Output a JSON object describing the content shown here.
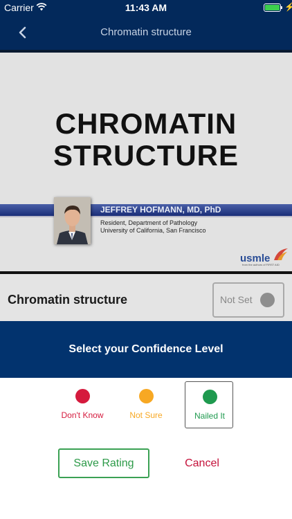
{
  "status_bar": {
    "carrier": "Carrier",
    "time": "11:43 AM",
    "wifi_icon": "wifi-icon",
    "battery_icon": "battery-icon",
    "charging_icon": "bolt-icon",
    "battery_level": 1.0,
    "battery_color": "#3ccf4e"
  },
  "nav": {
    "back_icon": "chevron-left-icon",
    "title": "Chromatin structure"
  },
  "slide": {
    "title_line1": "CHROMATIN",
    "title_line2": "STRUCTURE",
    "presenter_name": "JEFFREY HOFMANN, MD, PhD",
    "presenter_role_line1": "Resident, Department of Pathology",
    "presenter_role_line2": "University of California, San Francisco",
    "logo_text": "usmle",
    "logo_subtext": "from the authors of FIRST AID"
  },
  "topic": {
    "title": "Chromatin structure",
    "rating_label": "Not Set",
    "rating_color": "#8e8e8e"
  },
  "confidence": {
    "header": "Select your Confidence Level",
    "options": [
      {
        "label": "Don't Know",
        "color": "#d51a3d",
        "selected": false
      },
      {
        "label": "Not Sure",
        "color": "#f7a823",
        "selected": false
      },
      {
        "label": "Nailed It",
        "color": "#1f9a4f",
        "selected": true
      }
    ]
  },
  "actions": {
    "save_label": "Save Rating",
    "cancel_label": "Cancel"
  },
  "colors": {
    "nav_background": "#03295b",
    "confidence_header": "#02336e",
    "save_accent": "#3aa153",
    "cancel_accent": "#c4113a"
  }
}
